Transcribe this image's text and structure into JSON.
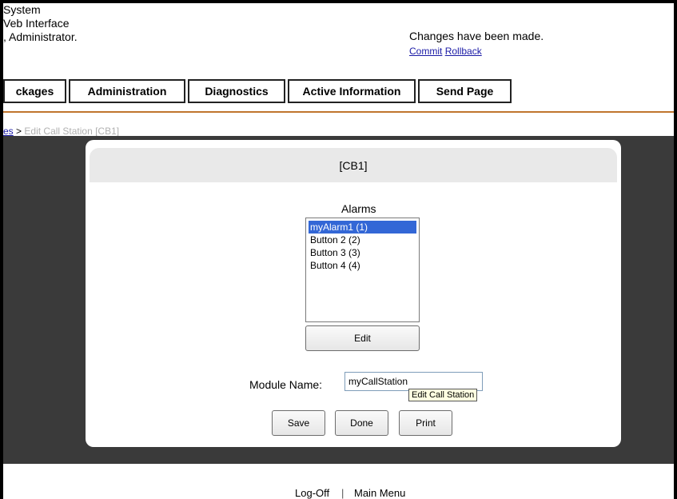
{
  "header": {
    "lines": [
      "System",
      "Veb Interface",
      ", Administrator."
    ],
    "status": "Changes have been made.",
    "commit_link": "Commit",
    "rollback_link": "Rollback"
  },
  "nav": {
    "tabs": [
      "ckages",
      "Administration",
      "Diagnostics",
      "Active Information",
      "Send Page"
    ]
  },
  "breadcrumb": {
    "parent_link": "es",
    "separator": ">",
    "current": "Edit Call Station [CB1]"
  },
  "panel": {
    "title": "[CB1]",
    "alarms": {
      "label": "Alarms",
      "items": [
        "myAlarm1 (1)",
        "Button 2 (2)",
        "Button 3 (3)",
        "Button 4 (4)"
      ],
      "selected_index": 0,
      "edit_label": "Edit"
    },
    "module": {
      "label": "Module Name:",
      "value": "myCallStation",
      "tooltip": "Edit Call Station"
    },
    "buttons": {
      "save": "Save",
      "done": "Done",
      "print": "Print"
    }
  },
  "footer": {
    "logoff": "Log-Off",
    "separator": "|",
    "main_menu": "Main Menu"
  },
  "colors": {
    "accent_rule": "#c0752e",
    "selection": "#3367d6",
    "link": "#1a1aa6"
  }
}
